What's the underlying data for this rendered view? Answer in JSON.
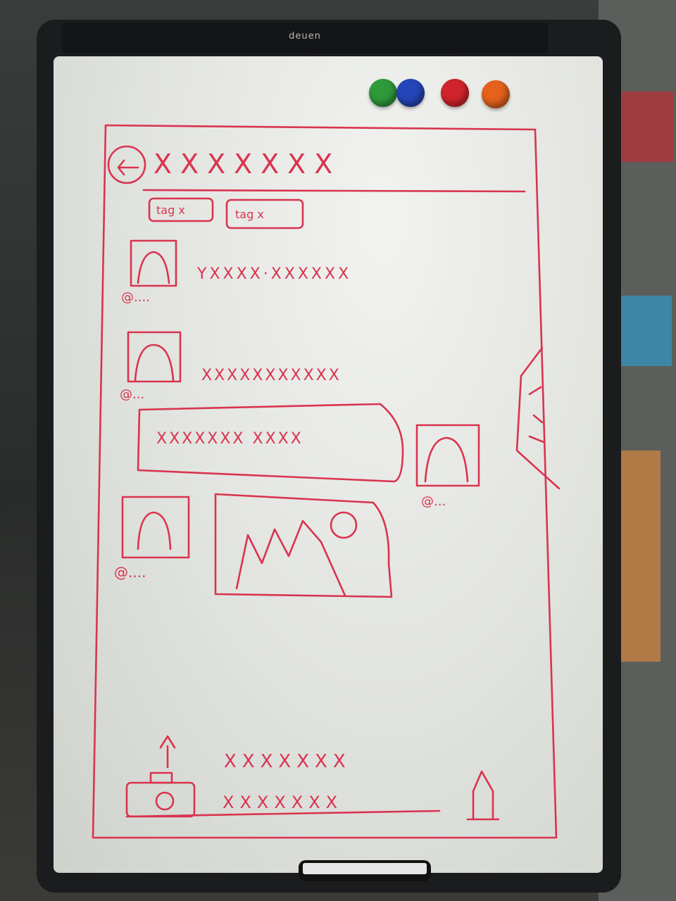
{
  "board": {
    "brand": "deuen",
    "magnets": [
      {
        "name": "green",
        "color": "#2f9a3a"
      },
      {
        "name": "blue",
        "color": "#2546b8"
      },
      {
        "name": "red",
        "color": "#d1232c"
      },
      {
        "name": "orange",
        "color": "#e4621c"
      }
    ],
    "ink_color": "#d9344f"
  },
  "sketch": {
    "title_placeholder": "XXXXXXX",
    "tags": [
      "tag x",
      "tag x"
    ],
    "messages": [
      {
        "handle": "@....",
        "text": "YXXXX·XXXXXX"
      },
      {
        "handle": "@...",
        "text": "XXXXXXXXXXX"
      },
      {
        "handle": "@...",
        "text": "XXXXXXX XXXX"
      },
      {
        "handle": "@....",
        "text": ""
      }
    ],
    "compose_lines": [
      "XXXXXXX",
      "XXXXXXX"
    ]
  }
}
